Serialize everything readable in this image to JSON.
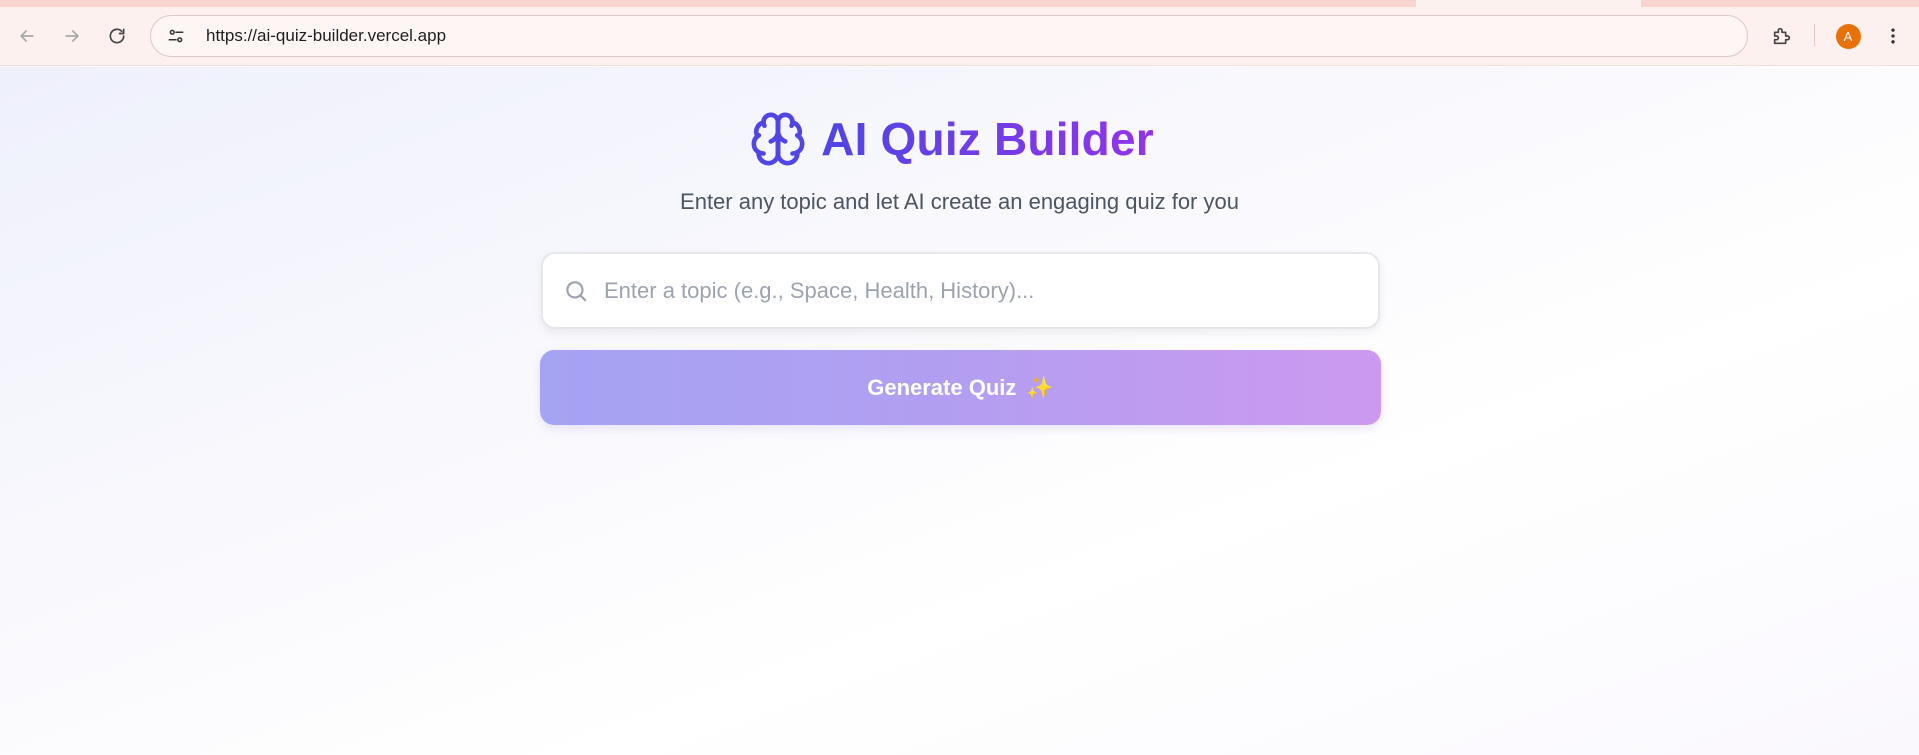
{
  "browser": {
    "url": "https://ai-quiz-builder.vercel.app",
    "avatar_letter": "A",
    "icons": {
      "back": "arrow-left-icon",
      "forward": "arrow-right-icon",
      "reload": "reload-icon",
      "site_info": "tune-icon",
      "extensions": "puzzle-icon",
      "menu": "kebab-menu-icon"
    }
  },
  "app": {
    "title": "AI Quiz Builder",
    "subtitle": "Enter any topic and let AI create an engaging quiz for you",
    "search": {
      "placeholder": "Enter a topic (e.g., Space, Health, History)...",
      "value": ""
    },
    "generate_button": {
      "label": "Generate Quiz",
      "icon": "✨"
    },
    "colors": {
      "title_gradient_start": "#4f46e5",
      "title_gradient_end": "#9333ea",
      "button_gradient_start": "#a5a3f3",
      "button_gradient_end": "#cc99f0"
    }
  }
}
